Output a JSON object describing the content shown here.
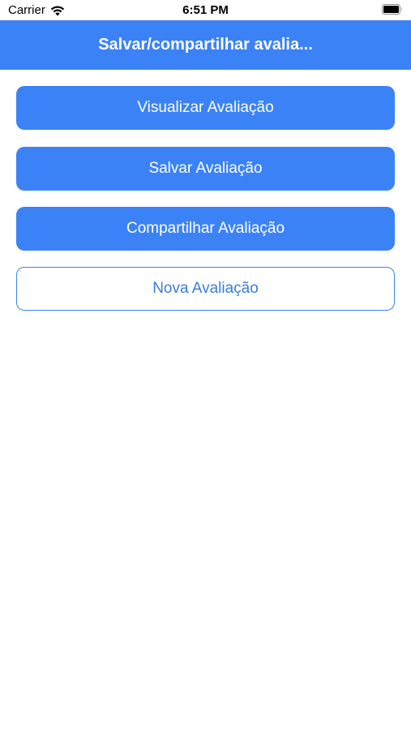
{
  "status_bar": {
    "carrier": "Carrier",
    "time": "6:51 PM",
    "wifi_icon": "wifi-icon",
    "battery_icon": "battery-icon"
  },
  "nav": {
    "title": "Salvar/compartilhar avalia..."
  },
  "buttons": {
    "view": "Visualizar Avaliação",
    "save": "Salvar Avaliação",
    "share": "Compartilhar Avaliação",
    "new": "Nova Avaliação"
  },
  "colors": {
    "accent": "#3b82f6",
    "outline_text": "#3b7ddb",
    "background": "#ffffff"
  }
}
